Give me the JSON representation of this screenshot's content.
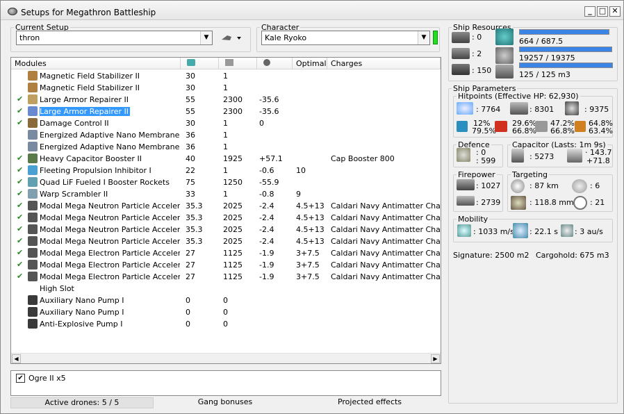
{
  "window": {
    "title": "Setups for Megathron Battleship"
  },
  "setup": {
    "legend": "Current Setup",
    "value": "thron"
  },
  "character": {
    "legend": "Character",
    "value": "Kale Ryoko"
  },
  "modules": {
    "headers": [
      "Modules",
      "",
      "",
      "",
      "Optimal",
      "Charges"
    ],
    "rows": [
      {
        "check": "",
        "name": "Magnetic Field Stabilizer II",
        "cpu": "30",
        "pg": "1",
        "cap": "",
        "optimal": "",
        "charges": "",
        "color": "#b08040"
      },
      {
        "check": "",
        "name": "Magnetic Field Stabilizer II",
        "cpu": "30",
        "pg": "1",
        "cap": "",
        "optimal": "",
        "charges": "",
        "color": "#b08040"
      },
      {
        "check": "✔",
        "name": "Large Armor Repairer II",
        "cpu": "55",
        "pg": "2300",
        "cap": "-35.6",
        "optimal": "",
        "charges": "",
        "color": "#c0a060"
      },
      {
        "check": "✔",
        "name": "Large Armor Repairer II",
        "cpu": "55",
        "pg": "2300",
        "cap": "-35.6",
        "optimal": "",
        "charges": "",
        "color": "#6a8ad0",
        "selected": true
      },
      {
        "check": "✔",
        "name": "Damage Control II",
        "cpu": "30",
        "pg": "1",
        "cap": "0",
        "optimal": "",
        "charges": "",
        "color": "#8a6a3a"
      },
      {
        "check": "",
        "name": "Energized Adaptive Nano Membrane II",
        "cpu": "36",
        "pg": "1",
        "cap": "",
        "optimal": "",
        "charges": "",
        "color": "#7a8aa0"
      },
      {
        "check": "",
        "name": "Energized Adaptive Nano Membrane II",
        "cpu": "36",
        "pg": "1",
        "cap": "",
        "optimal": "",
        "charges": "",
        "color": "#7a8aa0"
      },
      {
        "check": "✔",
        "name": "Heavy Capacitor Booster II",
        "cpu": "40",
        "pg": "1925",
        "cap": "+57.1",
        "optimal": "",
        "charges": "Cap Booster 800",
        "color": "#5a7a4a"
      },
      {
        "check": "✔",
        "name": "Fleeting Propulsion Inhibitor I",
        "cpu": "22",
        "pg": "1",
        "cap": "-0.6",
        "optimal": "10",
        "charges": "",
        "color": "#4aa0d0"
      },
      {
        "check": "✔",
        "name": "Quad LiF Fueled I Booster Rockets",
        "cpu": "75",
        "pg": "1250",
        "cap": "-55.9",
        "optimal": "",
        "charges": "",
        "color": "#60a0b0"
      },
      {
        "check": "✔",
        "name": "Warp Scrambler II",
        "cpu": "33",
        "pg": "1",
        "cap": "-0.8",
        "optimal": "9",
        "charges": "",
        "color": "#80a0b0"
      },
      {
        "check": "✔",
        "name": "Modal Mega Neutron Particle Accelerator I",
        "cpu": "35.3",
        "pg": "2025",
        "cap": "-2.4",
        "optimal": "4.5+13",
        "charges": "Caldari Navy Antimatter Charge L",
        "color": "#555555"
      },
      {
        "check": "✔",
        "name": "Modal Mega Neutron Particle Accelerator I",
        "cpu": "35.3",
        "pg": "2025",
        "cap": "-2.4",
        "optimal": "4.5+13",
        "charges": "Caldari Navy Antimatter Charge L",
        "color": "#555555"
      },
      {
        "check": "✔",
        "name": "Modal Mega Neutron Particle Accelerator I",
        "cpu": "35.3",
        "pg": "2025",
        "cap": "-2.4",
        "optimal": "4.5+13",
        "charges": "Caldari Navy Antimatter Charge L",
        "color": "#555555"
      },
      {
        "check": "✔",
        "name": "Modal Mega Neutron Particle Accelerator I",
        "cpu": "35.3",
        "pg": "2025",
        "cap": "-2.4",
        "optimal": "4.5+13",
        "charges": "Caldari Navy Antimatter Charge L",
        "color": "#555555"
      },
      {
        "check": "✔",
        "name": "Modal Mega Electron Particle Accelerator I",
        "cpu": "27",
        "pg": "1125",
        "cap": "-1.9",
        "optimal": "3+7.5",
        "charges": "Caldari Navy Antimatter Charge L",
        "color": "#555555"
      },
      {
        "check": "✔",
        "name": "Modal Mega Electron Particle Accelerator I",
        "cpu": "27",
        "pg": "1125",
        "cap": "-1.9",
        "optimal": "3+7.5",
        "charges": "Caldari Navy Antimatter Charge L",
        "color": "#555555"
      },
      {
        "check": "✔",
        "name": "Modal Mega Electron Particle Accelerator I",
        "cpu": "27",
        "pg": "1125",
        "cap": "-1.9",
        "optimal": "3+7.5",
        "charges": "Caldari Navy Antimatter Charge L",
        "color": "#555555"
      },
      {
        "check": "",
        "name": "High Slot",
        "cpu": "",
        "pg": "",
        "cap": "",
        "optimal": "",
        "charges": "",
        "color": "#ffffff"
      },
      {
        "check": "",
        "name": "Auxiliary Nano Pump I",
        "cpu": "0",
        "pg": "0",
        "cap": "",
        "optimal": "",
        "charges": "",
        "color": "#3a3a3a"
      },
      {
        "check": "",
        "name": "Auxiliary Nano Pump I",
        "cpu": "0",
        "pg": "0",
        "cap": "",
        "optimal": "",
        "charges": "",
        "color": "#3a3a3a"
      },
      {
        "check": "",
        "name": "Anti-Explosive Pump I",
        "cpu": "0",
        "pg": "0",
        "cap": "",
        "optimal": "",
        "charges": "",
        "color": "#3a3a3a"
      }
    ]
  },
  "drones": {
    "item": "Ogre II x5",
    "checked": "✔"
  },
  "status": {
    "drones": "Active drones: 5 / 5",
    "gang": "Gang bonuses",
    "projected": "Projected effects"
  },
  "resources": {
    "legend": "Ship Resources",
    "turrets": ": 0",
    "launchers": ": 2",
    "calibration": ": 150",
    "cpu": "664 / 687.5",
    "powergrid": "19257 / 19375",
    "drone_bay": "125 / 125 m3",
    "cpu_fill": 0.966,
    "powergrid_fill": 0.994,
    "drone_fill": 1.0
  },
  "parameters": {
    "legend": "Ship Parameters",
    "hitpoints": {
      "legend": "Hitpoints (Effective HP: 62,930)",
      "shield": ": 7764",
      "armor": ": 8301",
      "structure": ": 9375",
      "em_a": "12%",
      "em_b": "79.5%",
      "th_a": "29.6%",
      "th_b": "66.8%",
      "kin_a": "47.2%",
      "kin_b": "66.8%",
      "exp_a": "64.8%",
      "exp_b": "63.4%"
    },
    "defence": {
      "legend": "Defence",
      "a": ": 0",
      "b": ": 599"
    },
    "capacitor": {
      "legend": "Capacitor (Lasts: 1m 9s)",
      "amount": ": 5273",
      "delta_a": "· 143.7",
      "delta_b": "+71.8"
    },
    "firepower": {
      "legend": "Firepower",
      "a": ": 1027",
      "b": ": 2739"
    },
    "targeting": {
      "legend": "Targeting",
      "range": ": 87 km",
      "targets": ": 6",
      "resolution": ": 118.8 mm",
      "sensor": ": 21"
    },
    "mobility": {
      "legend": "Mobility",
      "speed": ": 1033 m/s",
      "align": ": 22.1 s",
      "warp": ": 3 au/s"
    },
    "signature": "Signature: 2500 m2",
    "cargohold": "Cargohold: 675 m3"
  }
}
